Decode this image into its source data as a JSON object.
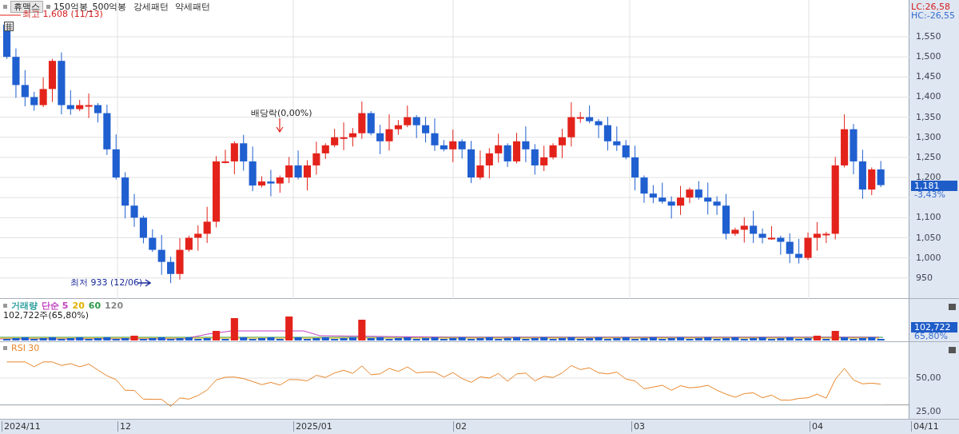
{
  "header": {
    "stock": "휴맥스",
    "legend": [
      "150억봉_500억봉",
      "강세패턴",
      "약세패턴"
    ]
  },
  "price_panel": {
    "high_marker": "최고 1,608 (11/13)",
    "event": "배당락(0,00%)",
    "low_marker": "최저 933 (12/06)",
    "lc": "LC:26,58",
    "hc": "HC:-26,55",
    "axis_labels": [
      "1,550",
      "1,500",
      "1,450",
      "1,400",
      "1,350",
      "1,300",
      "1,250",
      "1,200",
      "1,100",
      "1,050",
      "1,000",
      "950"
    ],
    "current_price": "1,181",
    "change": "-3,43%"
  },
  "volume_panel": {
    "legend": [
      {
        "label": "거래량",
        "color": "#2a9d9d"
      },
      {
        "label": "단순 5",
        "color": "#c040c0"
      },
      {
        "label": "20",
        "color": "#e0b000"
      },
      {
        "label": "60",
        "color": "#2e9a4a"
      },
      {
        "label": "120",
        "color": "#888888"
      }
    ],
    "reading": "102,722주(65,80%)",
    "current_volume": "102,722",
    "ratio": "65,80%"
  },
  "rsi_panel": {
    "title": "RSI 30",
    "axis_labels": [
      "50,00",
      "25,00"
    ]
  },
  "date_axis": [
    "2024/11",
    "12",
    "2025/01",
    "02",
    "03",
    "04",
    "04/11"
  ]
}
